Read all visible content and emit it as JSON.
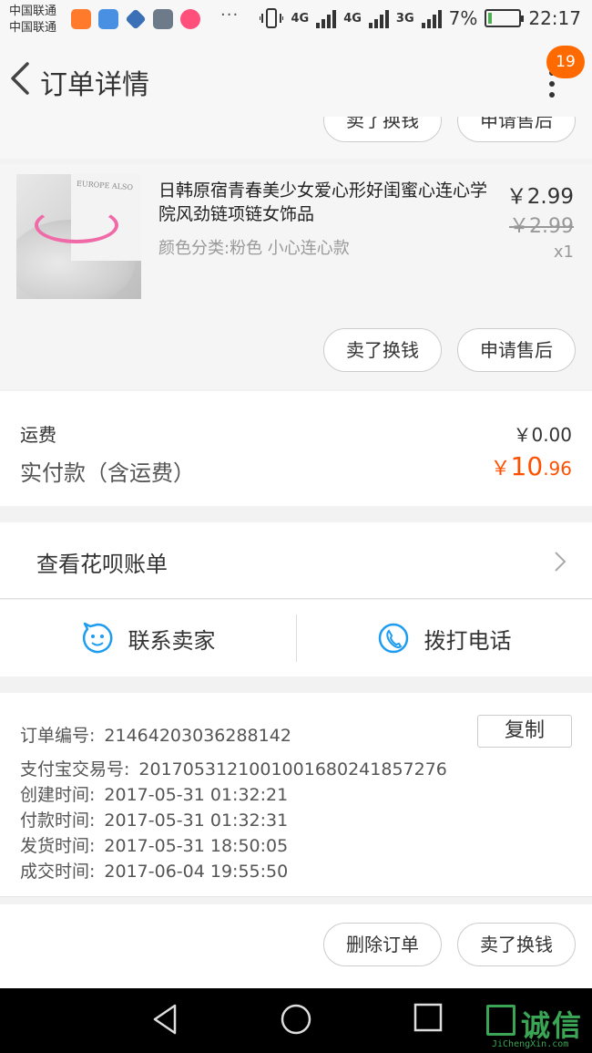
{
  "status_bar": {
    "carrier_1": "中国联通",
    "carrier_2": "中国联通",
    "network_1": "4G",
    "network_2": "4G",
    "network_3": "3G",
    "battery": "7%",
    "time": "22:17",
    "app_icon_colors": [
      "#ff7a2a",
      "#4a90e2",
      "#3b6fb6",
      "#6c7a89",
      "#ff4f7a"
    ],
    "accent_battery": "#4caf50"
  },
  "nav": {
    "title": "订单详情",
    "badge_count": "19",
    "badge_color": "#ff6a00"
  },
  "partial_top": {
    "button_1": "卖了换钱",
    "button_2": "申请售后"
  },
  "product": {
    "title": "日韩原宿青春美少女爱心形好闺蜜心连心学院风劲链项链女饰品",
    "sku": "颜色分类:粉色 小心连心款",
    "price": "￥2.99",
    "original_price": "￥2.99",
    "quantity": "x1",
    "image_text": "EUROPE ALSO",
    "sell_button": "卖了换钱",
    "aftersale_button": "申请售后"
  },
  "fees": {
    "shipping_label": "运费",
    "shipping_value": "￥0.00",
    "total_label": "实付款（含运费）",
    "total_prefix": "￥",
    "total_int": "10",
    "total_decimal": ".96",
    "total_color": "#ff5000"
  },
  "huabei": {
    "label": "查看花呗账单"
  },
  "contact": {
    "seller_label": "联系卖家",
    "call_label": "拨打电话",
    "icon_color": "#1e9cf0"
  },
  "order_info": {
    "order_no_label": "订单编号:",
    "order_no": "21464203036288142",
    "copy_label": "复制",
    "alipay_label": "支付宝交易号:",
    "alipay_no": "2017053121001001680241857276",
    "created_label": "创建时间:",
    "created": "2017-05-31 01:32:21",
    "paid_label": "付款时间:",
    "paid": "2017-05-31 01:32:31",
    "shipped_label": "发货时间:",
    "shipped": "2017-05-31 18:50:05",
    "completed_label": "成交时间:",
    "completed": "2017-06-04 19:55:50"
  },
  "bottom_actions": {
    "delete_label": "删除订单",
    "sell_label": "卖了换钱"
  },
  "watermark": {
    "text": "诚信",
    "domain": "JiChengXin.com"
  }
}
